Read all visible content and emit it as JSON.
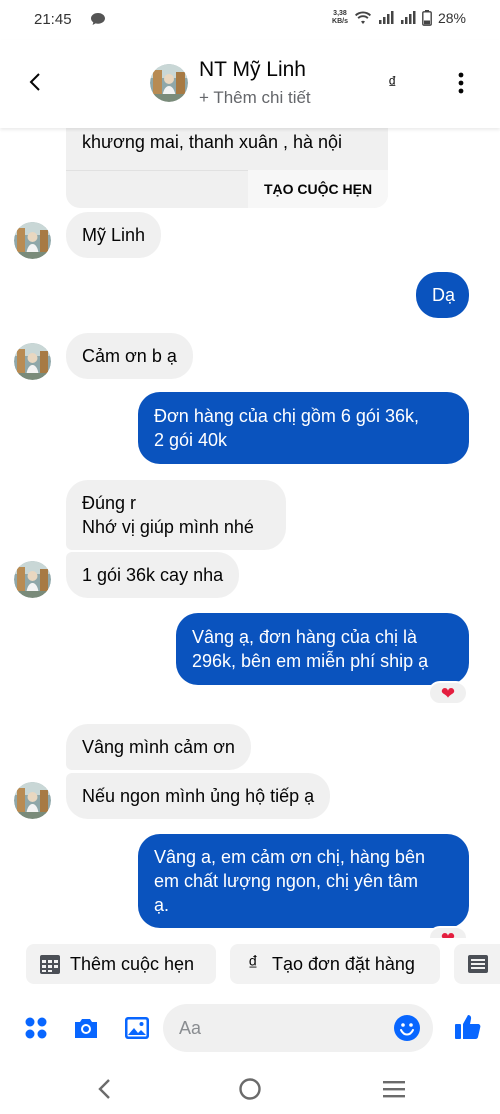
{
  "status": {
    "time": "21:45",
    "speed_value": "3,38",
    "speed_unit": "KB/s",
    "battery": "28%"
  },
  "header": {
    "name": "NT Mỹ Linh",
    "subtitle": "+ Thêm chi tiết",
    "currency": "₫"
  },
  "appointment_card": {
    "address_line": "khương mai, thanh xuân , hà nội",
    "button_label": "TẠO CUỘC HẸN"
  },
  "messages": [
    {
      "from": "in",
      "text": "Mỹ Linh"
    },
    {
      "from": "out",
      "text": "Dạ"
    },
    {
      "from": "in",
      "text": "Cảm ơn b ạ"
    },
    {
      "from": "out",
      "lines": [
        "Đơn hàng của chị gồm 6 gói 36k,",
        "2 gói 40k"
      ]
    },
    {
      "from": "in",
      "lines": [
        "Đúng r",
        "Nhớ vị giúp mình nhé"
      ]
    },
    {
      "from": "in",
      "text": "1 gói 36k cay nha"
    },
    {
      "from": "out",
      "lines": [
        "Vâng ạ, đơn hàng của chị là",
        "296k, bên em miễn phí ship ạ"
      ],
      "reaction": "❤"
    },
    {
      "from": "in",
      "text": "Vâng mình cảm ơn"
    },
    {
      "from": "in",
      "text": "Nếu ngon mình ủng hộ tiếp ạ"
    },
    {
      "from": "out",
      "lines": [
        "Vâng a, em cảm ơn chị, hàng bên",
        "em chất lượng ngon, chị yên tâm",
        "ạ."
      ],
      "reaction": "❤"
    }
  ],
  "actions": {
    "add_appointment": "Thêm cuộc hẹn",
    "create_order": "Tạo đơn đặt hàng",
    "create_order_icon": "₫"
  },
  "composer": {
    "placeholder": "Aa"
  },
  "colors": {
    "accent": "#0866ff",
    "outgoing_bubble": "#0a53be",
    "incoming_bubble": "#f0f0f0",
    "heart": "#e41e3f"
  }
}
